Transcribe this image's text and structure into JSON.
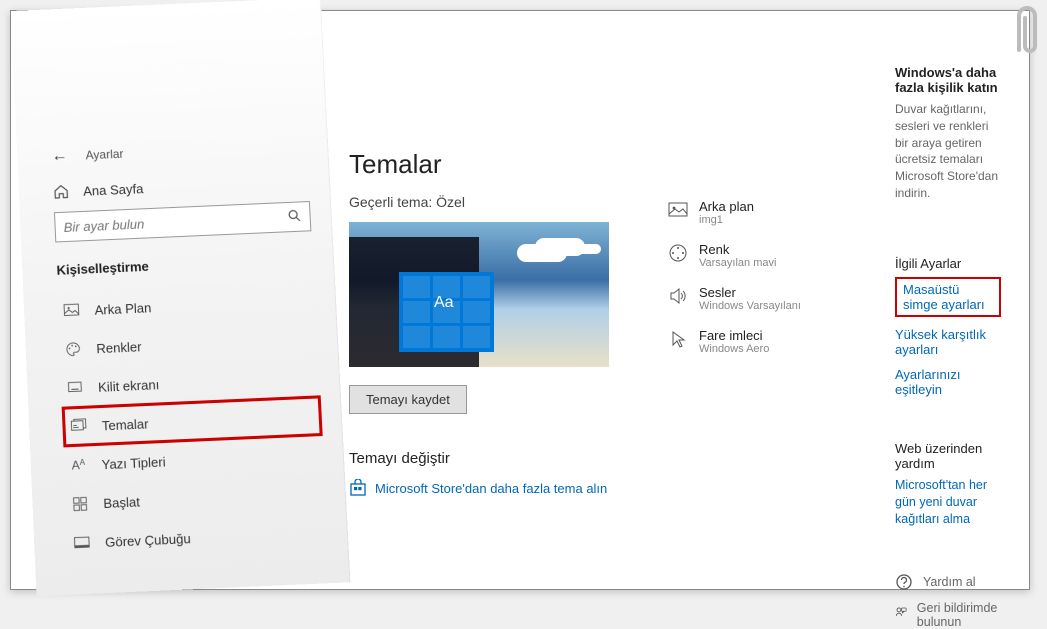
{
  "sidebar": {
    "back_label": "Ayarlar",
    "home_label": "Ana Sayfa",
    "search_placeholder": "Bir ayar bulun",
    "section_title": "Kişiselleştirme",
    "items": [
      {
        "label": "Arka Plan",
        "icon": "image"
      },
      {
        "label": "Renkler",
        "icon": "palette"
      },
      {
        "label": "Kilit ekranı",
        "icon": "lockscreen"
      },
      {
        "label": "Temalar",
        "icon": "themes",
        "highlighted": true
      },
      {
        "label": "Yazı Tipleri",
        "icon": "fonts"
      },
      {
        "label": "Başlat",
        "icon": "start"
      },
      {
        "label": "Görev Çubuğu",
        "icon": "taskbar"
      }
    ]
  },
  "main": {
    "page_title": "Temalar",
    "current_theme_prefix": "Geçerli tema:",
    "current_theme_value": "Özel",
    "preview_tile_text": "Aa",
    "save_button": "Temayı kaydet",
    "change_title": "Temayı değiştir",
    "store_link": "Microsoft Store'dan daha fazla tema alın"
  },
  "props": {
    "background": {
      "label": "Arka plan",
      "value": "img1"
    },
    "color": {
      "label": "Renk",
      "value": "Varsayılan mavi"
    },
    "sounds": {
      "label": "Sesler",
      "value": "Windows Varsayılanı"
    },
    "cursor": {
      "label": "Fare imleci",
      "value": "Windows Aero"
    }
  },
  "right": {
    "promo_title": "Windows'a daha fazla kişilik katın",
    "promo_text": "Duvar kağıtlarını, sesleri ve renkleri bir araya getiren ücretsiz temaları Microsoft Store'dan indirin.",
    "related_title": "İlgili Ayarlar",
    "links": {
      "desktop_icons": "Masaüstü simge ayarları",
      "high_contrast": "Yüksek karşıtlık ayarları",
      "sync": "Ayarlarınızı eşitleyin"
    },
    "web_help_title": "Web üzerinden yardım",
    "web_help_link": "Microsoft'tan her gün yeni duvar kağıtları alma",
    "get_help": "Yardım al",
    "feedback": "Geri bildirimde bulunun"
  }
}
